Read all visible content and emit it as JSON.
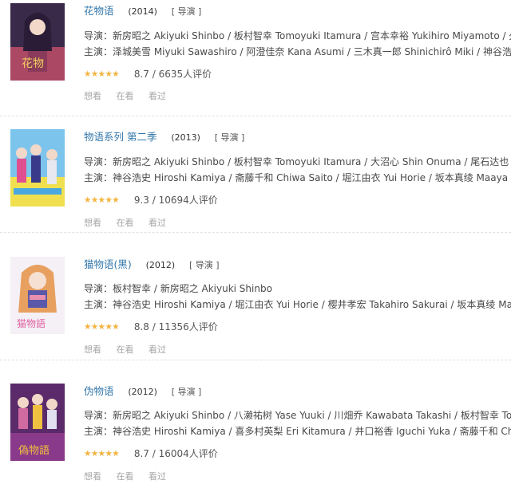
{
  "entries": [
    {
      "title": "花物语",
      "year": "(2014)",
      "playable": "[ 导演 ]",
      "director_label": "导演：",
      "directors": "新房昭之 Akiyuki Shinbo / 板村智幸 Tomoyuki Itamura / 宫本幸裕 Yukihiro Miyamoto / 久保...",
      "cast_label": "主演：",
      "cast": "泽城美雪 Miyuki Sawashiro / 阿澄佳奈 Kana Asumi / 三木真一郎 Shinichirô Miki / 神谷浩史...",
      "stars_text": "★★★★★",
      "star_fraction": 0.85,
      "score": "8.7",
      "votes": "6635人评价",
      "actions": [
        "想看",
        "在看",
        "看过"
      ],
      "poster_colors": [
        "#3a2a4a",
        "#c8506a",
        "#f0d060"
      ]
    },
    {
      "title": "物语系列 第二季",
      "year": "(2013)",
      "playable": "[ 导演 ]",
      "director_label": "导演：",
      "directors": "新房昭之 Akiyuki Shinbo / 板村智幸 Tomoyuki Itamura / 大沼心 Shin Onuma / 尾石达也 Tat...",
      "cast_label": "主演：",
      "cast": "神谷浩史 Hiroshi Kamiya / 斋藤千和 Chiwa Saito / 堀江由衣 Yui Horie / 坂本真绫 Maaya S...",
      "stars_text": "★★★★★",
      "star_fraction": 0.9,
      "score": "9.3",
      "votes": "10694人评价",
      "actions": [
        "想看",
        "在看",
        "看过"
      ],
      "poster_colors": [
        "#4aa8e0",
        "#f0e050",
        "#e05090"
      ]
    },
    {
      "title": "猫物语(黑)",
      "year": "(2012)",
      "playable": "[ 导演 ]",
      "director_label": "导演：",
      "directors": "板村智幸 / 新房昭之 Akiyuki Shinbo",
      "cast_label": "主演：",
      "cast": "神谷浩史 Hiroshi Kamiya / 堀江由衣 Yui Horie / 樱井孝宏 Takahiro Sakurai / 坂本真绫 Maa...",
      "stars_text": "★★★★★",
      "star_fraction": 0.85,
      "score": "8.8",
      "votes": "11356人评价",
      "actions": [
        "想看",
        "在看",
        "看过"
      ],
      "poster_colors": [
        "#f4f0f6",
        "#e890b0",
        "#5a58a8"
      ]
    },
    {
      "title": "伪物语",
      "year": "(2012)",
      "playable": "[ 导演 ]",
      "director_label": "导演：",
      "directors": "新房昭之 Akiyuki Shinbo / 八濑祐树 Yase Yuuki / 川畑乔 Kawabata Takashi / 板村智幸 Tom...",
      "cast_label": "主演：",
      "cast": "神谷浩史 Hiroshi Kamiya / 喜多村英梨 Eri Kitamura / 井口裕香 Iguchi Yuka / 斋藤千和 Chiw...",
      "stars_text": "★★★★★",
      "star_fraction": 0.85,
      "score": "8.7",
      "votes": "16004人评价",
      "actions": [
        "想看",
        "在看",
        "看过"
      ],
      "poster_colors": [
        "#5a2a6a",
        "#d06aa0",
        "#f0c040"
      ]
    }
  ]
}
